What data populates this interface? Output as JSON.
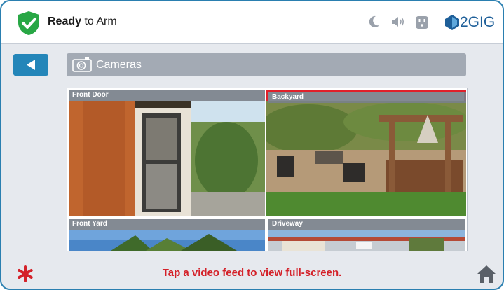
{
  "header": {
    "status_strong": "Ready",
    "status_rest": " to Arm",
    "brand": "2GIG",
    "icons": [
      "moon-icon",
      "speaker-icon",
      "outlet-icon"
    ]
  },
  "page": {
    "title": "Cameras"
  },
  "cameras": [
    {
      "label": "Front Door",
      "selected": false
    },
    {
      "label": "Backyard",
      "selected": true
    },
    {
      "label": "Front Yard",
      "selected": false
    },
    {
      "label": "Driveway",
      "selected": false
    }
  ],
  "footer": {
    "hint": "Tap a video feed to view full-screen."
  },
  "colors": {
    "accent": "#2486b9",
    "alert": "#d42129",
    "shield": "#28a745",
    "selected": "#e0202a"
  }
}
